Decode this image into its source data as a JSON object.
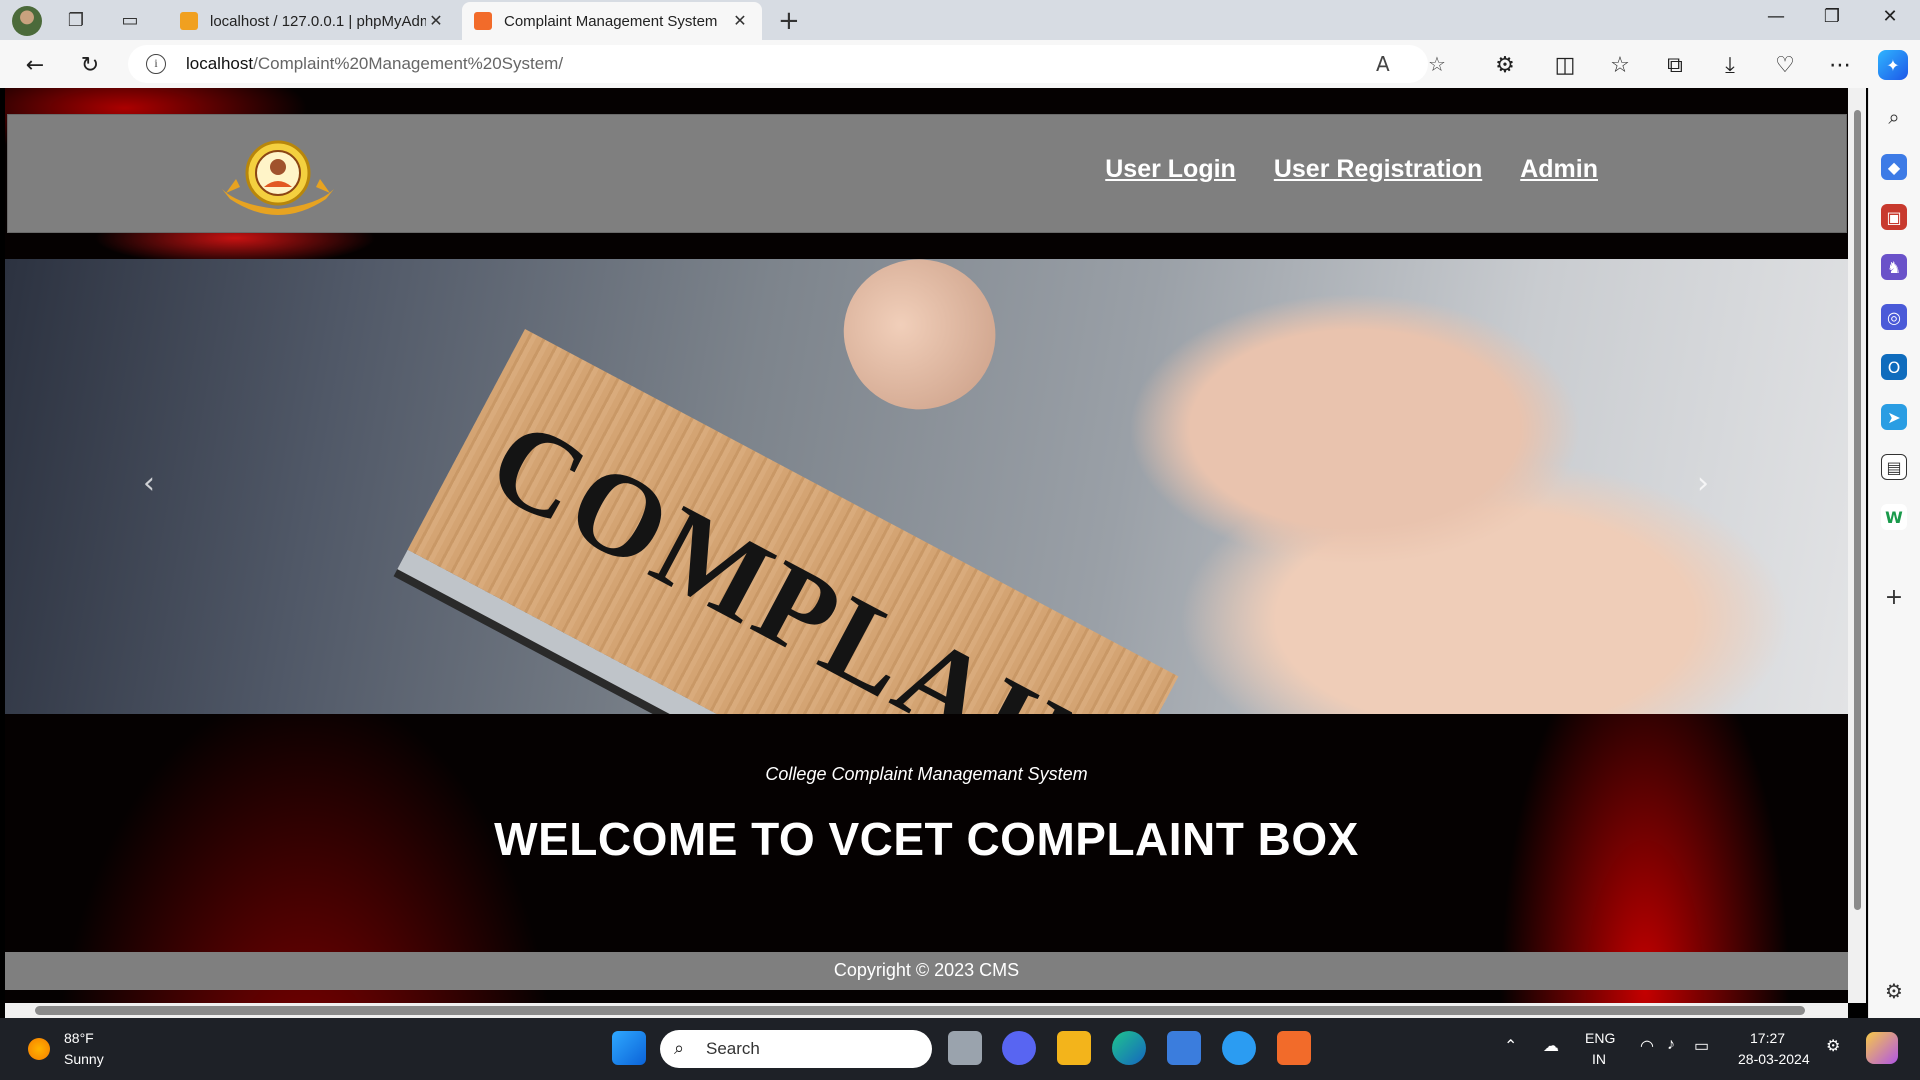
{
  "browser": {
    "tabs": [
      {
        "title": "localhost / 127.0.0.1 | phpMyAdmin",
        "active": false
      },
      {
        "title": "Complaint Management System",
        "active": true
      }
    ],
    "url_host": "localhost",
    "url_path": "/Complaint%20Management%20System/"
  },
  "site": {
    "nav": {
      "user_login": "User Login",
      "user_registration": "User Registration",
      "admin": "Admin"
    },
    "carousel": {
      "stamp_text": "COMPLAINT",
      "prev_glyph": "‹",
      "next_glyph": "›",
      "slides": 2,
      "active_slide": 1
    },
    "subtitle": "College Complaint Managemant System",
    "title": "WELCOME TO VCET COMPLAINT BOX",
    "footer": "Copyright © 2023 CMS"
  },
  "taskbar": {
    "weather_temp": "88°F",
    "weather_desc": "Sunny",
    "search_placeholder": "Search",
    "lang_line1": "ENG",
    "lang_line2": "IN",
    "time": "17:27",
    "date": "28-03-2024"
  },
  "colors": {
    "header_bg": "#7f7f7f",
    "page_bg": "#050101",
    "accent_red": "#d40000",
    "taskbar_bg": "#1e2127"
  }
}
